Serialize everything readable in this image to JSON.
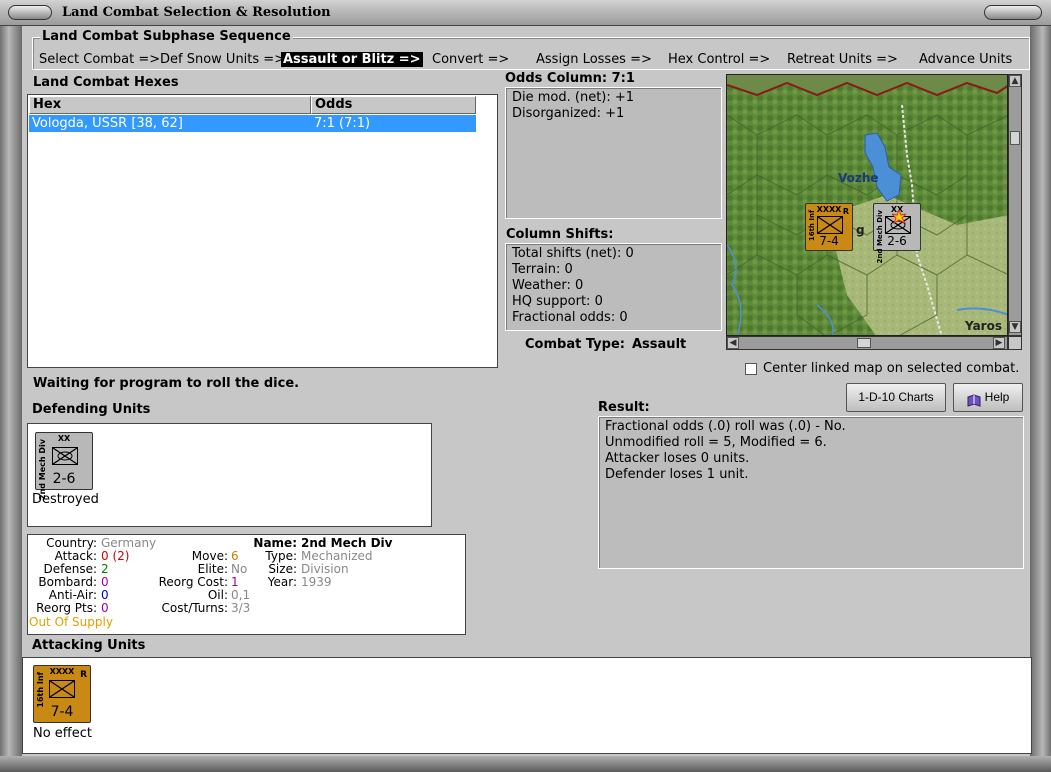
{
  "window": {
    "title": "Land Combat Selection & Resolution"
  },
  "subphase": {
    "title": "Land Combat Subphase Sequence",
    "steps": [
      "Select Combat =>",
      "Def Snow Units =>",
      "Assault or Blitz =>",
      "Convert =>",
      "Assign Losses =>",
      "Hex Control =>",
      "Retreat Units =>",
      "Advance Units"
    ],
    "active_step": "Assault or Blitz =>"
  },
  "hexes": {
    "title": "Land Combat Hexes",
    "columns": [
      "Hex",
      "Odds"
    ],
    "rows": [
      {
        "hex": "Vologda, USSR [38, 62]",
        "odds": "7:1 (7:1)"
      }
    ]
  },
  "odds": {
    "title": "Odds Column: 7:1",
    "lines": [
      "Die mod. (net): +1",
      "Disorganized: +1"
    ]
  },
  "shifts": {
    "title": "Column Shifts:",
    "lines": [
      "Total shifts (net): 0",
      "Terrain: 0",
      "Weather: 0",
      "HQ support: 0",
      "Fractional odds: 0"
    ]
  },
  "combat_type": {
    "label": "Combat Type:",
    "value": "Assault"
  },
  "map": {
    "place_label": "Vozhe",
    "edge_label": "Yaros",
    "partial_label": "g",
    "attacker_counter": {
      "size": "XXXX",
      "side": "16th Inf",
      "badge": "R",
      "str": "7-4"
    },
    "defender_counter": {
      "size": "XX",
      "side": "2nd Mech Div",
      "str": "2-6"
    },
    "colors": {
      "attacker": "#c88a14",
      "defender": "#b8b8b8",
      "forest": "#5f8a3a",
      "clear": "#a8b878",
      "water": "#4b8fd6",
      "border": "#8a1a1a"
    }
  },
  "center_map": {
    "label": "Center linked map on selected combat.",
    "checked": false
  },
  "status": "Waiting for program to roll the dice.",
  "buttons": {
    "charts": "1-D-10 Charts",
    "help": "Help"
  },
  "result": {
    "title": "Result:",
    "lines": [
      "Fractional odds (.0) roll was (.0)  - No.",
      "Unmodified roll = 5, Modified = 6.",
      "Attacker loses 0 units.",
      "Defender loses 1 unit."
    ]
  },
  "defending": {
    "title": "Defending Units",
    "units": [
      {
        "side": "2nd Mech Div",
        "size": "XX",
        "str": "2-6",
        "status": "Destroyed"
      }
    ]
  },
  "unit_info": {
    "country_label": "Country:",
    "country": "Germany",
    "attack_label": "Attack:",
    "attack": "0 (2)",
    "defense_label": "Defense:",
    "defense": "2",
    "bombard_label": "Bombard:",
    "bombard": "0",
    "antiair_label": "Anti-Air:",
    "antiair": "0",
    "reorgpts_label": "Reorg Pts:",
    "reorgpts": "0",
    "supply": "Out Of Supply",
    "move_label": "Move:",
    "move": "6",
    "elite_label": "Elite:",
    "elite": "No",
    "reorgcost_label": "Reorg Cost:",
    "reorgcost": "1",
    "oil_label": "Oil:",
    "oil": "0,1",
    "costturns_label": "Cost/Turns:",
    "costturns": "3/3",
    "name_label": "Name:",
    "name": "2nd Mech Div",
    "type_label": "Type:",
    "type": "Mechanized",
    "size_label": "Size:",
    "size": "Division",
    "year_label": "Year:",
    "year": "1939"
  },
  "attacking": {
    "title": "Attacking Units",
    "units": [
      {
        "side": "16th Inf",
        "size": "XXXX",
        "badge": "R",
        "str": "7-4",
        "status": "No effect"
      }
    ]
  }
}
